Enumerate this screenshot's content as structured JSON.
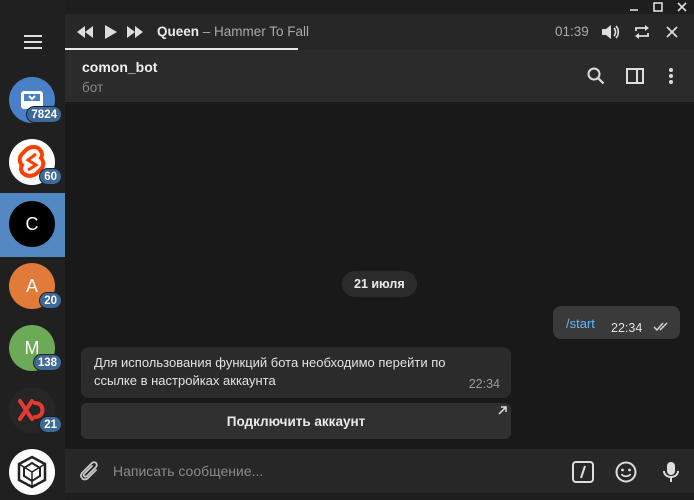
{
  "player": {
    "artist": "Queen",
    "separator": " – ",
    "track": "Hammer To Fall",
    "time": "01:39",
    "progress": 0.41
  },
  "chat": {
    "title": "comon_bot",
    "subtitle": "бот"
  },
  "sidebar": {
    "items": [
      {
        "name": "chat-saved",
        "letter": "",
        "color": "#4a80c7",
        "badge": "7824"
      },
      {
        "name": "chat-svelte",
        "letter": "",
        "color": "#ffffff",
        "badge": "60"
      },
      {
        "name": "chat-c",
        "letter": "C",
        "color": "#000000",
        "badge": ""
      },
      {
        "name": "chat-a",
        "letter": "A",
        "color": "#e07b39",
        "badge": "20"
      },
      {
        "name": "chat-m",
        "letter": "M",
        "color": "#6caa57",
        "badge": "138"
      },
      {
        "name": "chat-x",
        "letter": "",
        "color": "#262626",
        "badge": "21"
      },
      {
        "name": "chat-geo",
        "letter": "",
        "color": "#ffffff",
        "badge": ""
      }
    ]
  },
  "messages": {
    "date": "21 июля",
    "outgoing": {
      "text": "/start",
      "time": "22:34"
    },
    "incoming": {
      "text": "Для использования функций бота необходимо перейти по ссылке в настройках аккаунта",
      "time": "22:34"
    },
    "inline_button": "Подключить аккаунт"
  },
  "composer": {
    "placeholder": "Написать сообщение..."
  },
  "colors": {
    "accent": "#5288c1",
    "badge": "#3e6a99",
    "link": "#6ab3f3"
  }
}
